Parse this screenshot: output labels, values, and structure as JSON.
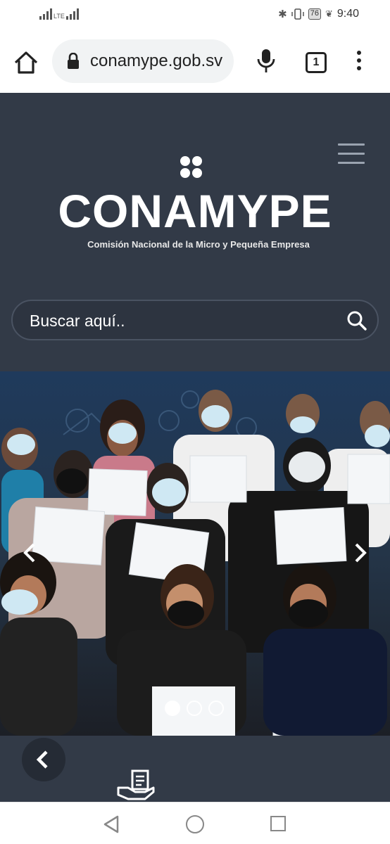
{
  "status_bar": {
    "network": "LTE",
    "battery": "76",
    "time": "9:40"
  },
  "browser": {
    "url": "conamype.gob.sv",
    "tab_count": "1"
  },
  "site": {
    "brand": "CONAMYPE",
    "tagline": "Comisión Nacional de la Micro y Pequeña Empresa",
    "search": {
      "placeholder": "Buscar aquí.."
    },
    "carousel": {
      "slide_count": 3,
      "active_slide": 1
    }
  },
  "colors": {
    "header_bg": "#323a47",
    "search_border": "#4a5362",
    "fab_bg": "#252b35"
  }
}
